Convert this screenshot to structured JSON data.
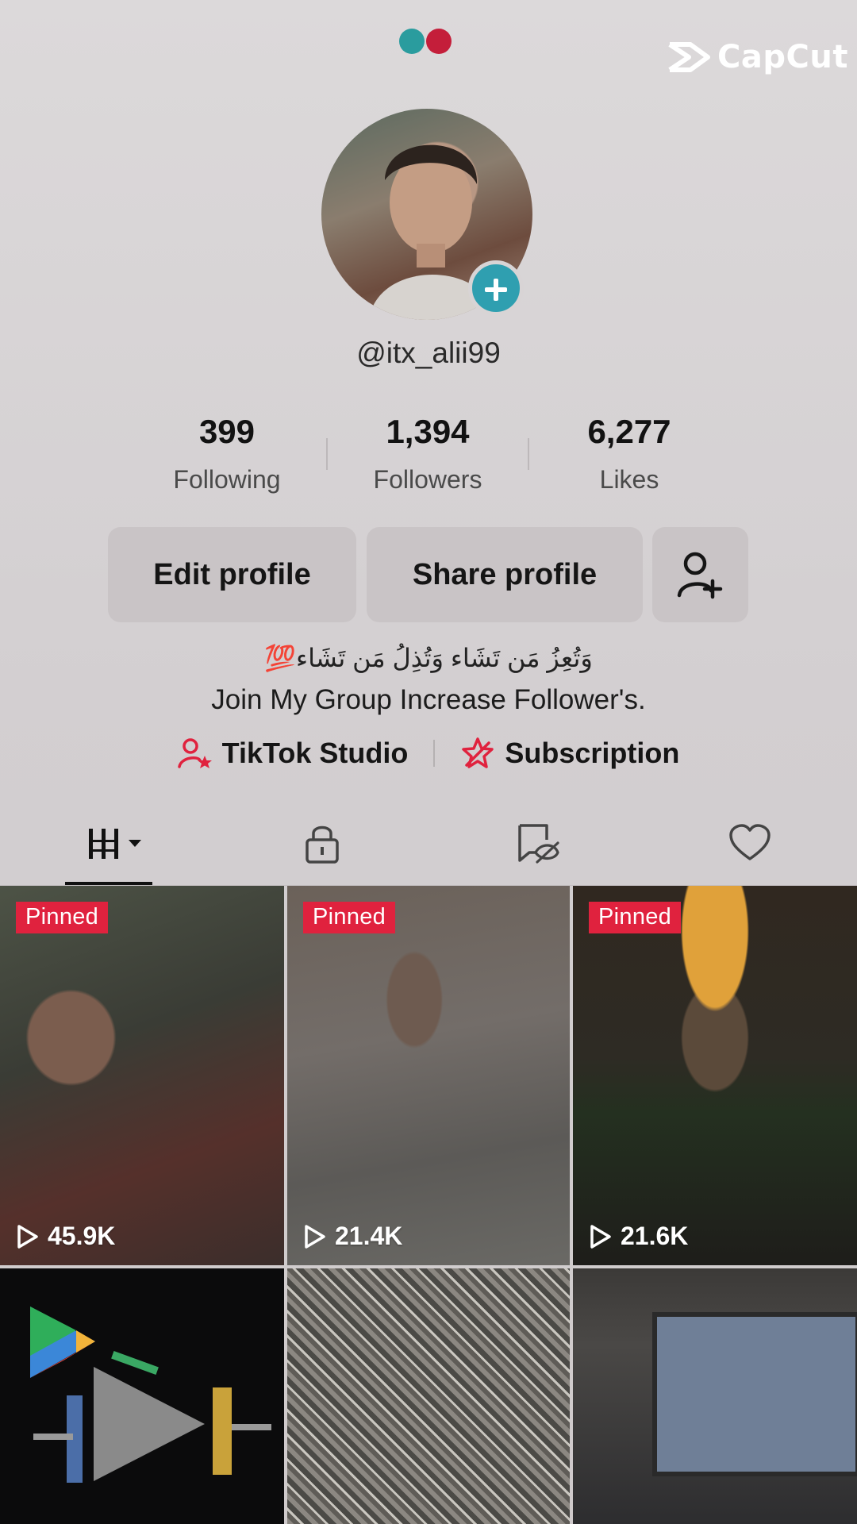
{
  "watermark": {
    "brand": "CapCut"
  },
  "profile": {
    "username": "@itx_alii99",
    "stats": [
      {
        "value": "399",
        "label": "Following"
      },
      {
        "value": "1,394",
        "label": "Followers"
      },
      {
        "value": "6,277",
        "label": "Likes"
      }
    ],
    "buttons": {
      "edit": "Edit profile",
      "share": "Share profile"
    },
    "bio_line1": "وَتُعِزُ مَن تَشَاء وَتُذِلُ مَن تَشَاء💯",
    "bio_line2": "Join My Group Increase Follower's.",
    "links": {
      "studio": "TikTok Studio",
      "subscription": "Subscription"
    }
  },
  "tabs": [
    "videos-grid",
    "private-lock",
    "reposts",
    "liked"
  ],
  "videos": [
    {
      "pinned": "Pinned",
      "views": "45.9K"
    },
    {
      "pinned": "Pinned",
      "views": "21.4K"
    },
    {
      "pinned": "Pinned",
      "views": "21.6K"
    },
    {
      "views": ""
    },
    {
      "views": ""
    },
    {
      "views": ""
    }
  ],
  "colors": {
    "accent": "#e0223e",
    "teal": "#2f9fb0"
  }
}
